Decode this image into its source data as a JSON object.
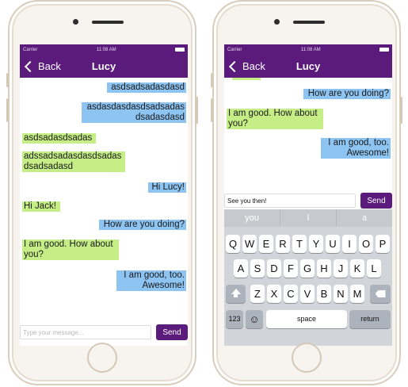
{
  "status": {
    "carrier": "Carrier",
    "time": "11:08 AM"
  },
  "nav": {
    "back_label": "Back",
    "title": "Lucy"
  },
  "left": {
    "messages": [
      {
        "side": "right",
        "text": "asdsadsadasdasd"
      },
      {
        "side": "right",
        "text": "asdasdasdasdsadsadasdsadasdasd"
      },
      {
        "side": "left",
        "text": "asdsadasdsadas"
      },
      {
        "side": "left",
        "text": "adssadsadasdasdsadasdsadsadasd"
      },
      {
        "side": "right",
        "text": "Hi Lucy!"
      },
      {
        "side": "left",
        "text": "Hi Jack!"
      },
      {
        "side": "right",
        "text": "How are you doing?"
      },
      {
        "side": "left",
        "text": "I am good. How about you?"
      },
      {
        "side": "right",
        "text": "I am good, too. Awesome!"
      }
    ],
    "input_placeholder": "Type your message...",
    "input_value": "",
    "send_label": "Send"
  },
  "right": {
    "messages": [
      {
        "side": "right",
        "text": "How are you doing?"
      },
      {
        "side": "left",
        "text": "I am good. How about you?"
      },
      {
        "side": "right",
        "text": "I am good, too. Awesome!"
      }
    ],
    "input_placeholder": "",
    "input_value": "See you then!",
    "send_label": "Send"
  },
  "keyboard": {
    "suggestions": [
      "you",
      "I",
      "a"
    ],
    "row1": [
      "Q",
      "W",
      "E",
      "R",
      "T",
      "Y",
      "U",
      "I",
      "O",
      "P"
    ],
    "row2": [
      "A",
      "S",
      "D",
      "F",
      "G",
      "H",
      "J",
      "K",
      "L"
    ],
    "row3": [
      "Z",
      "X",
      "C",
      "V",
      "B",
      "N",
      "M"
    ],
    "numbers_label": "123",
    "space_label": "space",
    "return_label": "return",
    "emoji": "☺"
  },
  "colors": {
    "nav": "#5b1b7c",
    "outgoing": "#8ec4f2",
    "incoming": "#c6ee87"
  }
}
